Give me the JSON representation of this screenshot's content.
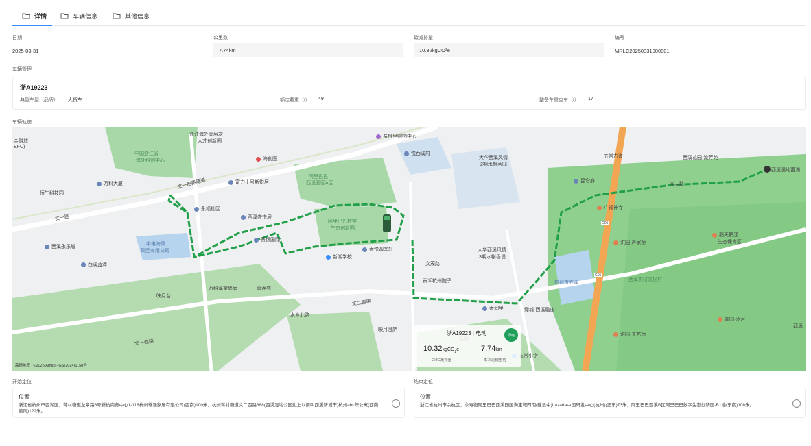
{
  "tabs": [
    {
      "label": "详情"
    },
    {
      "label": "车辆信息"
    },
    {
      "label": "其他信息"
    }
  ],
  "fields": {
    "date": {
      "label": "日期",
      "value": "2025-03-31"
    },
    "mileage": {
      "label": "公里数",
      "value": "7.74km"
    },
    "carbon": {
      "label": "碳减排量",
      "value_main": "10.32kgCO",
      "value_sub": "2",
      "value_end": "e"
    },
    "code": {
      "label": "编号",
      "value": "MRLC20250331000001"
    }
  },
  "vehicle_section": {
    "label": "车辆管理",
    "plate": "浙A19223",
    "type_label": "典型车型（品牌）",
    "type_value": "大货车",
    "load_label": "额定载重（t）",
    "load_value": "49",
    "empty_label": "整备车重空车（t）",
    "empty_value": "17"
  },
  "track_section": {
    "label": "车辆轨迹",
    "popup": {
      "title": "浙A19223 | 电动",
      "badge": "绿电",
      "ghg_value": "10.32",
      "ghg_unit": "kgCO",
      "ghg_unit_sub": "2",
      "ghg_unit_end": "e",
      "ghg_caption": "GHG减排量",
      "dist_value": "7.74",
      "dist_unit": "km",
      "dist_caption": "本次运输里程"
    },
    "attribution": "高德地图 | ©2025 Amap - GS(2024)1158号",
    "map_labels": {
      "l1": "金融城",
      "l2": "EFC)",
      "l3": "浙江海外高层次",
      "l4": "人才创新园",
      "l5": "中国浙江省",
      "l6": "海外科创中心",
      "l7": "万科大厦",
      "l8": "海创园",
      "l9": "富力十号新悦居",
      "l10": "阿里巴巴",
      "l11": "西溪园区A区",
      "l12": "恒生科技园",
      "l13": "永福社区",
      "l14": "西溪盛悦居",
      "l15": "阿里巴巴数字",
      "l16": "生态创新园",
      "l17": "赛银国际",
      "l18": "新湖学校",
      "l19": "香悦四季轩",
      "l20": "西溪永乐城",
      "l21": "西溪蓝海",
      "l22": "中电海康",
      "l23": "集团有限公司",
      "l24": "万科溪望尚庭",
      "l25": "草莲苑",
      "l26": "映月台",
      "l27": "水乡北路",
      "l28": "映月澄庐",
      "l29": "西园",
      "l30": "亲橙里购物中心",
      "l31": "悦西溪府",
      "l32": "大华西溪风情",
      "l33": "2期水榭茗邸",
      "l34": "大华西溪风情",
      "l35": "3期水榭香堤",
      "l36": "泰禾杭州院子",
      "l37": "文茂路",
      "l38": "香润里",
      "l39": "绿城·西溪融庄",
      "l40": "杭州市胜溪",
      "l41": "五常小学",
      "l42": "五常古道",
      "l43": "昆仑府",
      "l44": "西溪花园·流芳苑",
      "l45": "西溪湿地蓄湖",
      "l46": "广福神寺",
      "l47": "洪园·严家桥",
      "l48": "西溪农耕文化村",
      "l49": "洪园·关艺桥",
      "l50": "鹳天鹳漾",
      "l51": "生态保育区",
      "l52": "蒙园·泛月",
      "l53": "文一西路隧道",
      "l54": "文二西路",
      "l55": "文一西路",
      "l56": "文二路",
      "l57": "G05",
      "l58": "G05",
      "l59": "西溪",
      "l60": "文一路"
    }
  },
  "start_loc": {
    "label": "开始定位",
    "title": "位置",
    "text": "浙江省杭州市西湖区，蒋村街道龙章路6号新杭商务中心1-118杭州尊涵家居有限公司(西南)100米，杭州蒋村街道文二西路888(西溪湿地公园边上以前叫西溪新城市)杭州abc陈公寓(西南偏南)122米。"
  },
  "end_loc": {
    "label": "结束定位",
    "title": "位置",
    "text": "浙江省杭州市余杭区，永寿街阿里巴巴西溪园区淘宝城四期(建设中)Lazada中国研发中心(杭州)(正东)73米，阿里巴巴西溪B区阿里巴巴数字生态创新园-B1楼(东南)108米。"
  }
}
